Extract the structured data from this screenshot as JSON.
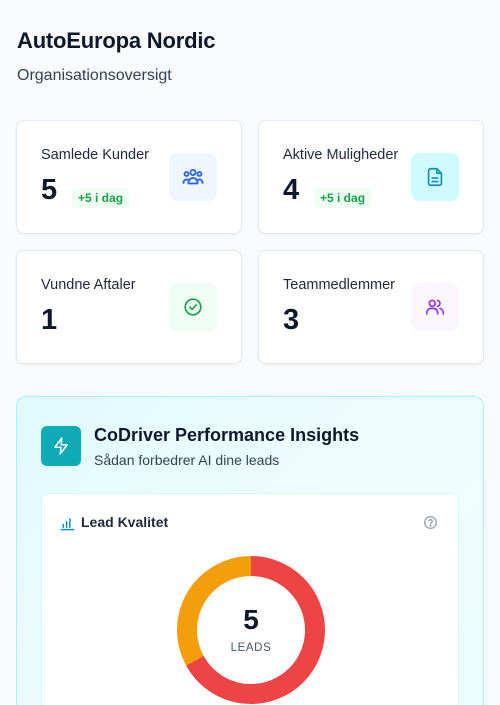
{
  "header": {
    "title": "AutoEuropa Nordic",
    "subtitle": "Organisationsoversigt"
  },
  "stats": [
    {
      "label": "Samlede Kunder",
      "value": "5",
      "badge": "+5 i dag",
      "icon": "users-icon",
      "icon_color": "#2563eb",
      "icon_bg": "#eff6ff"
    },
    {
      "label": "Aktive Muligheder",
      "value": "4",
      "badge": "+5 i dag",
      "icon": "document-icon",
      "icon_color": "#0891b2",
      "icon_bg": "#cffafe"
    },
    {
      "label": "Vundne Aftaler",
      "value": "1",
      "icon": "check-circle-icon",
      "icon_color": "#16a34a",
      "icon_bg": "#f0fdf4"
    },
    {
      "label": "Teammedlemmer",
      "value": "3",
      "icon": "team-icon",
      "icon_color": "#9333ea",
      "icon_bg": "#faf5ff"
    }
  ],
  "insights": {
    "title": "CoDriver Performance Insights",
    "subtitle": "Sådan forbedrer AI dine leads",
    "icon": "lightning-icon",
    "lead_quality": {
      "title": "Lead Kvalitet",
      "total": "5",
      "total_label": "LEADS",
      "segments": [
        {
          "value": 3.35,
          "color": "#ef4444"
        },
        {
          "value": 1.65,
          "color": "#f59e0b"
        }
      ]
    }
  }
}
